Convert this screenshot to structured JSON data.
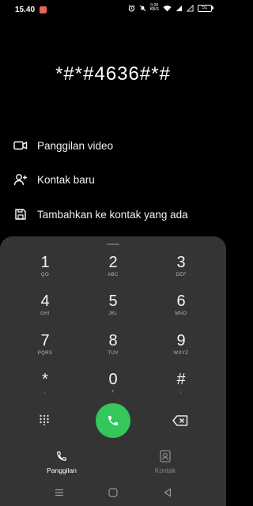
{
  "status_bar": {
    "time": "15.40",
    "network_speed_value": "0,00",
    "network_speed_unit": "KB/S",
    "battery_level": "51"
  },
  "dialed_number": "*#*#4636#*#",
  "actions": [
    {
      "label": "Panggilan video",
      "icon": "video-icon"
    },
    {
      "label": "Kontak baru",
      "icon": "add-person-icon"
    },
    {
      "label": "Tambahkan ke kontak yang ada",
      "icon": "save-icon"
    }
  ],
  "keypad": {
    "keys": [
      {
        "digit": "1",
        "letters": "QO"
      },
      {
        "digit": "2",
        "letters": "ABC"
      },
      {
        "digit": "3",
        "letters": "DEF"
      },
      {
        "digit": "4",
        "letters": "GHI"
      },
      {
        "digit": "5",
        "letters": "JKL"
      },
      {
        "digit": "6",
        "letters": "MNO"
      },
      {
        "digit": "7",
        "letters": "PQRS"
      },
      {
        "digit": "8",
        "letters": "TUV"
      },
      {
        "digit": "9",
        "letters": "WXYZ"
      },
      {
        "digit": "*",
        "letters": ","
      },
      {
        "digit": "0",
        "letters": "+"
      },
      {
        "digit": "#",
        "letters": ";"
      }
    ]
  },
  "tabs": {
    "calls_label": "Panggilan",
    "contacts_label": "Kontak"
  },
  "colors": {
    "background": "#000000",
    "panel": "#343434",
    "call_button": "#34c759",
    "inactive_tab": "#8a8a8a"
  }
}
